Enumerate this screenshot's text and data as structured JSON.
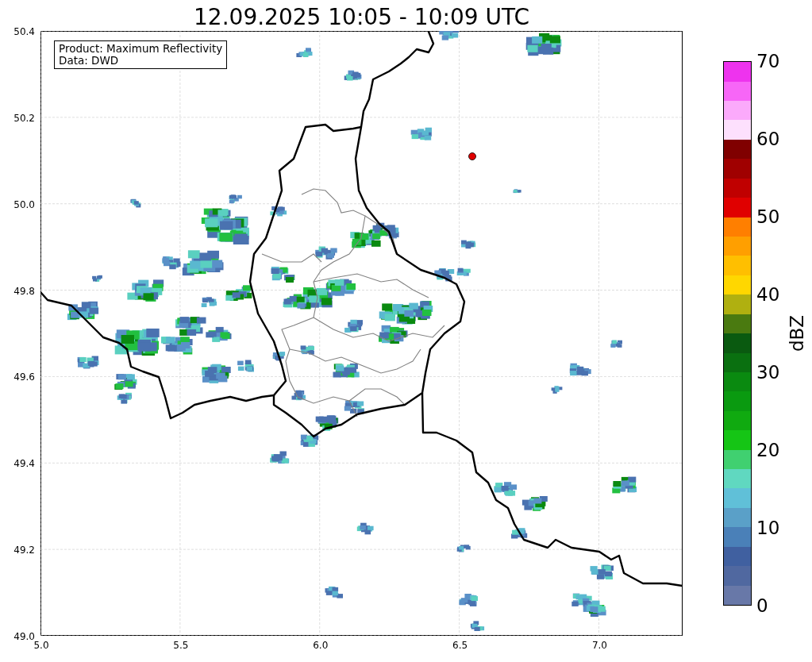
{
  "title": "12.09.2025 10:05 - 10:09 UTC",
  "legend": {
    "lines": [
      "Product: Maximum Reflectivity",
      "Data: DWD"
    ]
  },
  "map": {
    "x_ticks": [
      "5.0",
      "5.5",
      "6.0",
      "6.5",
      "7.0"
    ],
    "y_ticks": [
      "50.4",
      "50.2",
      "50.0",
      "49.8",
      "49.6",
      "49.4",
      "49.2",
      "49.0"
    ]
  },
  "colorbar": {
    "label": "dBZ",
    "ticks": [
      "70",
      "60",
      "50",
      "40",
      "30",
      "20",
      "10",
      "0"
    ],
    "bins": [
      {
        "color": "#6878a8"
      },
      {
        "color": "#5068a0"
      },
      {
        "color": "#4060a0"
      },
      {
        "color": "#4a80b8"
      },
      {
        "color": "#5aa0c8"
      },
      {
        "color": "#60c0d8"
      },
      {
        "color": "#60d8c0"
      },
      {
        "color": "#40d070"
      },
      {
        "color": "#15c515"
      },
      {
        "color": "#10aa10"
      },
      {
        "color": "#0a9a10"
      },
      {
        "color": "#0a8a10"
      },
      {
        "color": "#0a7010"
      },
      {
        "color": "#0a5a10"
      },
      {
        "color": "#4a7a10"
      },
      {
        "color": "#b0b010"
      },
      {
        "color": "#ffd700"
      },
      {
        "color": "#ffbf00"
      },
      {
        "color": "#ff9f00"
      },
      {
        "color": "#ff7f00"
      },
      {
        "color": "#e00000"
      },
      {
        "color": "#c00000"
      },
      {
        "color": "#a00000"
      },
      {
        "color": "#800000"
      },
      {
        "color": "#fde0fd"
      },
      {
        "color": "#fbaafb"
      },
      {
        "color": "#f766f7"
      },
      {
        "color": "#ee33ee"
      }
    ]
  }
}
